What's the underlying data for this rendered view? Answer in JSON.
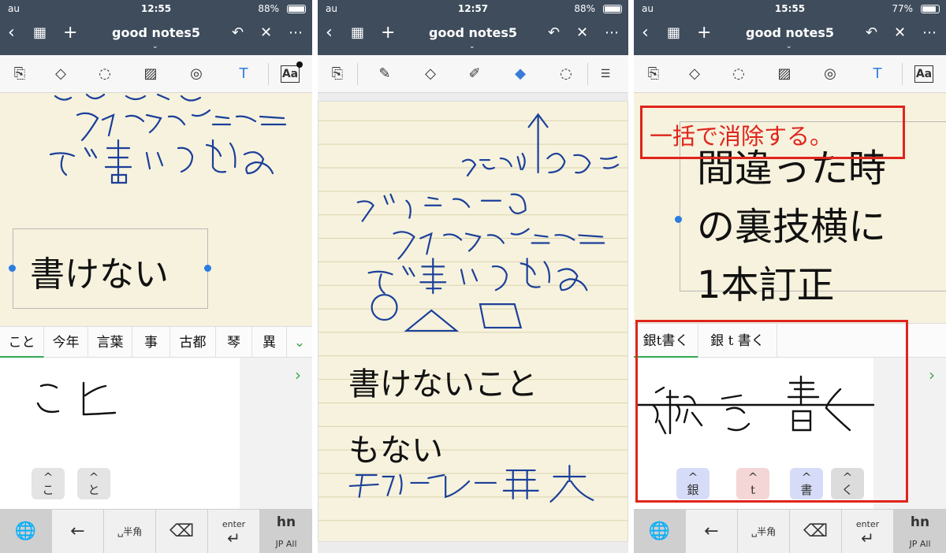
{
  "app": {
    "title": "good notes5",
    "title_chevron": "⌄",
    "accent": "#2a7de1",
    "navbar_color": "#3e4c5c",
    "highlight_color": "#e0241b"
  },
  "panels": [
    {
      "status": {
        "carrier": "au",
        "time": "12:55",
        "battery": "88%",
        "battery_level": 0.88
      },
      "typed_text": "書けない",
      "candidates": [
        "こと",
        "今年",
        "言葉",
        "事",
        "古都",
        "琴",
        "異"
      ],
      "handwriting_input": "こと",
      "keys": [
        "こ",
        "と"
      ],
      "keys_mark": "^"
    },
    {
      "status": {
        "carrier": "au",
        "time": "12:57",
        "battery": "88%",
        "battery_level": 0.88
      },
      "typed_lines": [
        "書けないこと",
        "もない"
      ]
    },
    {
      "status": {
        "carrier": "au",
        "time": "15:55",
        "battery": "77%",
        "battery_level": 0.77
      },
      "annotation": "一括で消除する。",
      "typed_lines": [
        "間違った時",
        "の裏技横に",
        "1本訂正"
      ],
      "candidates": [
        "銀t書く",
        "銀 t 書く"
      ],
      "keys": [
        "銀",
        "t",
        "書",
        "く"
      ],
      "keys_mark": "^"
    }
  ],
  "keyboard": {
    "globe": "🌐",
    "back": "←",
    "space": "␣半角",
    "delete": "⌫",
    "enter": "enter",
    "enter_arrow": "↵",
    "jp_label": "JP All",
    "jp_icon": "hn"
  },
  "nav_icons": [
    "chevron-left-icon",
    "grid-icon",
    "plus-icon",
    "undo-icon",
    "pen-off-icon",
    "more-icon"
  ]
}
